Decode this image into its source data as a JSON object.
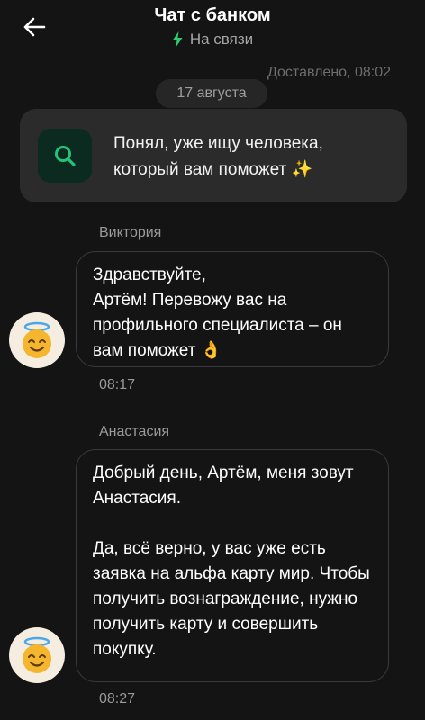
{
  "header": {
    "title": "Чат с банком",
    "status": "На связи"
  },
  "delivered_label": "Доставлено, 08:02",
  "date_separator": "17 августа",
  "system_message": {
    "text": "Понял, уже ищу человека, который вам поможет ✨"
  },
  "messages": [
    {
      "sender": "Виктория",
      "text": "Здравствуйте,\nАртём! Перевожу вас на профильного специалиста – он вам поможет 👌",
      "time": "08:17"
    },
    {
      "sender": "Анастасия",
      "text": "Добрый день, Артём, меня зовут Анастасия.\n\nДа, всё верно, у вас уже есть заявка на альфа карту мир. Чтобы получить вознаграждение, нужно получить карту и совершить покупку.",
      "time": "08:27"
    }
  ],
  "colors": {
    "background": "#141414",
    "status_icon": "#2ecc71",
    "search_icon_bg": "#0b2a20",
    "search_icon": "#25c27a"
  },
  "icons": {
    "back": "back-arrow-icon",
    "status": "lightning-icon",
    "system": "search-icon",
    "avatar": "angel-emoji-icon"
  }
}
